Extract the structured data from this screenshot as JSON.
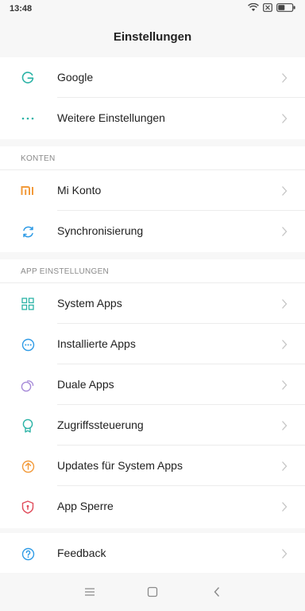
{
  "status": {
    "time": "13:48"
  },
  "header": {
    "title": "Einstellungen"
  },
  "sections": {
    "konten": "KONTEN",
    "app": "APP EINSTELLUNGEN"
  },
  "items": {
    "google": "Google",
    "weitere": "Weitere Einstellungen",
    "mikonto": "Mi Konto",
    "sync": "Synchronisierung",
    "systemapps": "System Apps",
    "installierte": "Installierte Apps",
    "duale": "Duale Apps",
    "zugriff": "Zugriffssteuerung",
    "updates": "Updates für System Apps",
    "sperre": "App Sperre",
    "feedback": "Feedback"
  },
  "icons": {
    "google": "google-icon",
    "weitere": "more-dots-icon",
    "mikonto": "mi-logo-icon",
    "sync": "sync-icon",
    "systemapps": "grid-apps-icon",
    "installierte": "installed-apps-icon",
    "duale": "dual-apps-icon",
    "zugriff": "access-control-icon",
    "updates": "update-icon",
    "sperre": "app-lock-icon",
    "feedback": "feedback-icon"
  },
  "colors": {
    "teal": "#2bb3a6",
    "orange": "#f29a3a",
    "purple": "#a78bd8",
    "red": "#e04b5a",
    "blue": "#2f9be6",
    "chevron": "#c4c4c4"
  }
}
